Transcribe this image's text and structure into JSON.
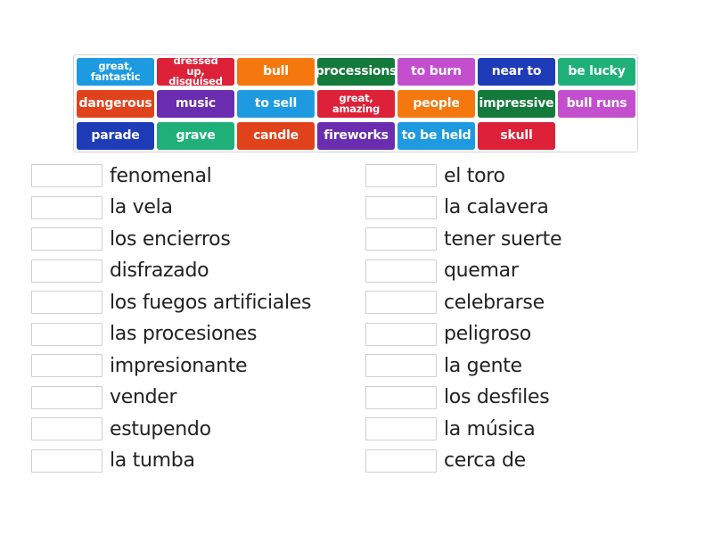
{
  "tiles": [
    {
      "label": "great, fantastic",
      "color": "#1e9be0",
      "small": true
    },
    {
      "label": "dressed up, disguised",
      "color": "#dc2139",
      "small": true
    },
    {
      "label": "bull",
      "color": "#f5780f",
      "small": false
    },
    {
      "label": "processions",
      "color": "#147a3c",
      "small": false
    },
    {
      "label": "to burn",
      "color": "#c34fcf",
      "small": false
    },
    {
      "label": "near to",
      "color": "#1e3bb8",
      "small": false
    },
    {
      "label": "be lucky",
      "color": "#1fb07a",
      "small": false
    },
    {
      "label": "dangerous",
      "color": "#e0421c",
      "small": false
    },
    {
      "label": "music",
      "color": "#6a2db0",
      "small": false
    },
    {
      "label": "to sell",
      "color": "#1e9be0",
      "small": false
    },
    {
      "label": "great, amazing",
      "color": "#dc2139",
      "small": true
    },
    {
      "label": "people",
      "color": "#f5780f",
      "small": false
    },
    {
      "label": "impressive",
      "color": "#147a3c",
      "small": false
    },
    {
      "label": "bull runs",
      "color": "#c34fcf",
      "small": false
    },
    {
      "label": "parade",
      "color": "#1e3bb8",
      "small": false
    },
    {
      "label": "grave",
      "color": "#1fb07a",
      "small": false
    },
    {
      "label": "candle",
      "color": "#e0421c",
      "small": false
    },
    {
      "label": "fireworks",
      "color": "#6a2db0",
      "small": false
    },
    {
      "label": "to be held",
      "color": "#1e9be0",
      "small": false
    },
    {
      "label": "skull",
      "color": "#dc2139",
      "small": false
    }
  ],
  "left_words": [
    "fenomenal",
    "la vela",
    "los encierros",
    "disfrazado",
    "los fuegos artificiales",
    "las procesiones",
    "impresionante",
    "vender",
    "estupendo",
    "la tumba"
  ],
  "right_words": [
    "el toro",
    "la calavera",
    "tener suerte",
    "quemar",
    "celebrarse",
    "peligroso",
    "la gente",
    "los desfiles",
    "la música",
    "cerca de"
  ]
}
